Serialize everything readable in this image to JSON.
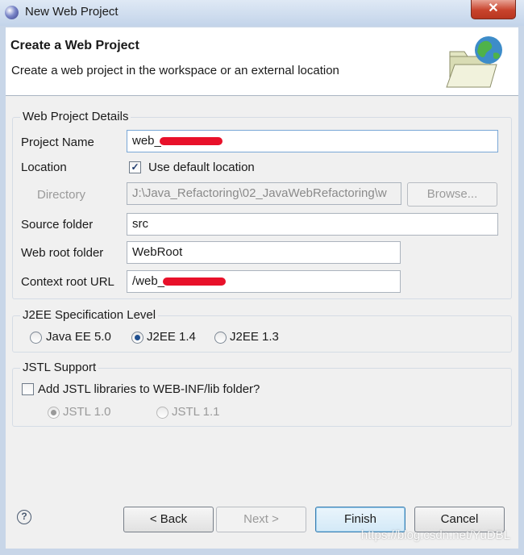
{
  "window": {
    "title": "New Web Project",
    "close_label": "✕"
  },
  "header": {
    "title": "Create a Web Project",
    "description": "Create a web project in the workspace or an external location"
  },
  "details": {
    "group_label": "Web Project Details",
    "project_name_label": "Project Name",
    "project_name_value": "web_",
    "location_label": "Location",
    "use_default_label": "Use default location",
    "use_default_checked": true,
    "directory_label": "Directory",
    "directory_value": "J:\\Java_Refactoring\\02_JavaWebRefactoring\\w",
    "browse_label": "Browse...",
    "source_folder_label": "Source folder",
    "source_folder_value": "src",
    "web_root_label": "Web root folder",
    "web_root_value": "WebRoot",
    "context_root_label": "Context root URL",
    "context_root_value": "/web_"
  },
  "j2ee": {
    "group_label": "J2EE Specification Level",
    "options": [
      "Java EE 5.0",
      "J2EE 1.4",
      "J2EE 1.3"
    ],
    "selected": "J2EE 1.4"
  },
  "jstl": {
    "group_label": "JSTL Support",
    "add_label": "Add JSTL libraries to WEB-INF/lib folder?",
    "add_checked": false,
    "options": [
      "JSTL 1.0",
      "JSTL 1.1"
    ],
    "selected": "JSTL 1.0"
  },
  "footer": {
    "help_label": "?",
    "back_label": "< Back",
    "next_label": "Next >",
    "finish_label": "Finish",
    "cancel_label": "Cancel"
  },
  "watermark": "https://blog.csdn.net/YuDBL",
  "colors": {
    "accent": "#3c7fb1",
    "redaction": "#e8112a",
    "titlebar": "#c3d4ea"
  }
}
